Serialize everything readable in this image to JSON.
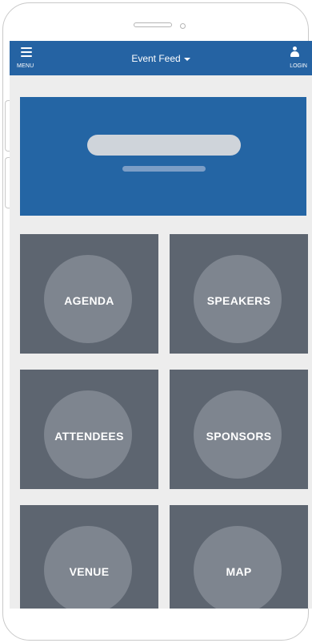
{
  "header": {
    "menu_label": "MENU",
    "title": "Event Feed",
    "login_label": "LOGIN"
  },
  "tiles": [
    {
      "label": "AGENDA"
    },
    {
      "label": "SPEAKERS"
    },
    {
      "label": "ATTENDEES"
    },
    {
      "label": "SPONSORS"
    },
    {
      "label": "VENUE"
    },
    {
      "label": "MAP"
    }
  ],
  "colors": {
    "header": "#2563a3",
    "banner": "#2465a4",
    "tile": "#5d6570",
    "tile_circle": "#7e858f",
    "screen_bg": "#ededed"
  },
  "icons": [
    "hamburger-icon",
    "caret-down-icon",
    "user-icon"
  ]
}
